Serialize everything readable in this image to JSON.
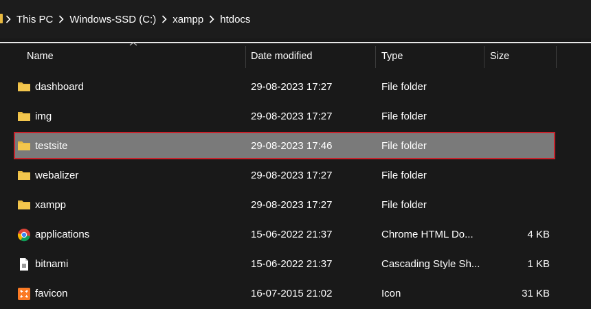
{
  "breadcrumb": [
    "This PC",
    "Windows-SSD (C:)",
    "xampp",
    "htdocs"
  ],
  "columns": {
    "name": "Name",
    "date": "Date modified",
    "type": "Type",
    "size": "Size"
  },
  "files": [
    {
      "name": "dashboard",
      "date": "29-08-2023 17:27",
      "type": "File folder",
      "size": "",
      "icon": "folder-icon",
      "selected": false
    },
    {
      "name": "img",
      "date": "29-08-2023 17:27",
      "type": "File folder",
      "size": "",
      "icon": "folder-icon",
      "selected": false
    },
    {
      "name": "testsite",
      "date": "29-08-2023 17:46",
      "type": "File folder",
      "size": "",
      "icon": "folder-icon",
      "selected": true
    },
    {
      "name": "webalizer",
      "date": "29-08-2023 17:27",
      "type": "File folder",
      "size": "",
      "icon": "folder-icon",
      "selected": false
    },
    {
      "name": "xampp",
      "date": "29-08-2023 17:27",
      "type": "File folder",
      "size": "",
      "icon": "folder-icon",
      "selected": false
    },
    {
      "name": "applications",
      "date": "15-06-2022 21:37",
      "type": "Chrome HTML Do...",
      "size": "4 KB",
      "icon": "chrome-icon",
      "selected": false
    },
    {
      "name": "bitnami",
      "date": "15-06-2022 21:37",
      "type": "Cascading Style Sh...",
      "size": "1 KB",
      "icon": "css-file-icon",
      "selected": false
    },
    {
      "name": "favicon",
      "date": "16-07-2015 21:02",
      "type": "Icon",
      "size": "31 KB",
      "icon": "xampp-icon",
      "selected": false
    }
  ],
  "colors": {
    "background": "#191919",
    "folder": "#e8b93f",
    "selection": "#7a7a7a",
    "selection_border": "#c8232c"
  }
}
